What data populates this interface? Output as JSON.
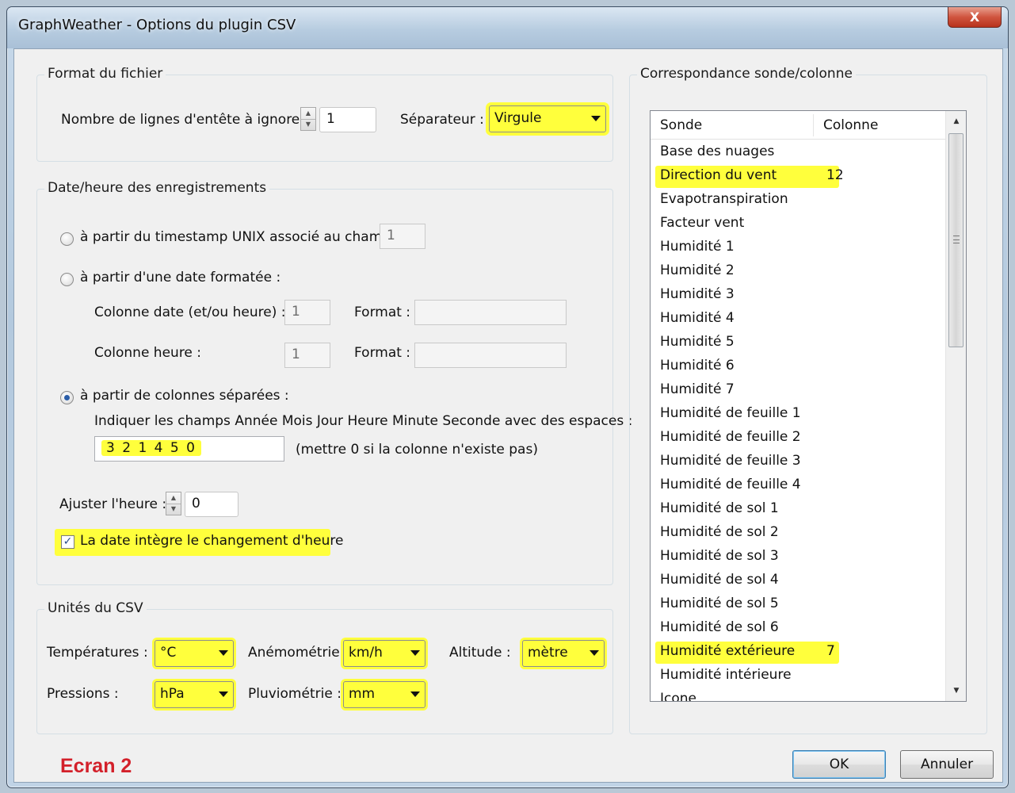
{
  "window": {
    "title": "GraphWeather - Options du plugin CSV",
    "close_label": "X"
  },
  "format": {
    "group_title": "Format du fichier",
    "header_lines_label": "Nombre de lignes d'entête à ignorer:",
    "header_lines_value": "1",
    "separator_label": "Séparateur :",
    "separator_value": "Virgule"
  },
  "datetime": {
    "group_title": "Date/heure des enregistrements",
    "opt_unix_label": "à partir du timestamp UNIX associé au champ :",
    "opt_unix_value": "1",
    "opt_formatted_label": "à partir d'une date formatée :",
    "col_date_label": "Colonne date (et/ou heure) :",
    "col_date_value": "1",
    "format1_label": "Format :",
    "format1_value": "",
    "col_time_label": "Colonne heure :",
    "col_time_value": "1",
    "format2_label": "Format :",
    "format2_value": "",
    "opt_separate_label": "à partir de colonnes séparées :",
    "fields_instruction": "Indiquer les champs Année Mois Jour Heure Minute Seconde avec des espaces :",
    "fields_value": "3 2 1 4 5 0",
    "fields_hint": "(mettre 0 si la colonne n'existe pas)",
    "adjust_label": "Ajuster l'heure :",
    "adjust_value": "0",
    "dst_label": "La date intègre le changement d'heure",
    "dst_checked": true,
    "selected_option": "separate"
  },
  "units": {
    "group_title": "Unités du CSV",
    "temperature_label": "Températures :",
    "temperature_value": "°C",
    "anemometry_label": "Anémométrie :",
    "anemometry_value": "km/h",
    "altitude_label": "Altitude :",
    "altitude_value": "mètre",
    "pressure_label": "Pressions :",
    "pressure_value": "hPa",
    "rain_label": "Pluviométrie :",
    "rain_value": "mm"
  },
  "mapping": {
    "group_title": "Correspondance sonde/colonne",
    "headers": [
      "Sonde",
      "Colonne"
    ],
    "rows": [
      {
        "sonde": "Base des nuages",
        "colonne": ""
      },
      {
        "sonde": "Direction du vent",
        "colonne": "12"
      },
      {
        "sonde": "Evapotranspiration",
        "colonne": ""
      },
      {
        "sonde": "Facteur vent",
        "colonne": ""
      },
      {
        "sonde": "Humidité 1",
        "colonne": ""
      },
      {
        "sonde": "Humidité 2",
        "colonne": ""
      },
      {
        "sonde": "Humidité 3",
        "colonne": ""
      },
      {
        "sonde": "Humidité 4",
        "colonne": ""
      },
      {
        "sonde": "Humidité 5",
        "colonne": ""
      },
      {
        "sonde": "Humidité 6",
        "colonne": ""
      },
      {
        "sonde": "Humidité 7",
        "colonne": ""
      },
      {
        "sonde": "Humidité de feuille 1",
        "colonne": ""
      },
      {
        "sonde": "Humidité de feuille 2",
        "colonne": ""
      },
      {
        "sonde": "Humidité de feuille 3",
        "colonne": ""
      },
      {
        "sonde": "Humidité de feuille 4",
        "colonne": ""
      },
      {
        "sonde": "Humidité de sol 1",
        "colonne": ""
      },
      {
        "sonde": "Humidité de sol 2",
        "colonne": ""
      },
      {
        "sonde": "Humidité de sol 3",
        "colonne": ""
      },
      {
        "sonde": "Humidité de sol 4",
        "colonne": ""
      },
      {
        "sonde": "Humidité de sol 5",
        "colonne": ""
      },
      {
        "sonde": "Humidité de sol 6",
        "colonne": ""
      },
      {
        "sonde": "Humidité extérieure",
        "colonne": "7"
      },
      {
        "sonde": "Humidité intérieure",
        "colonne": ""
      },
      {
        "sonde": "Icone",
        "colonne": ""
      }
    ]
  },
  "buttons": {
    "ok": "OK",
    "cancel": "Annuler"
  },
  "annotation": {
    "label": "Ecran 2",
    "color": "#d3202a"
  },
  "colors": {
    "highlight": "#ffff3c"
  }
}
